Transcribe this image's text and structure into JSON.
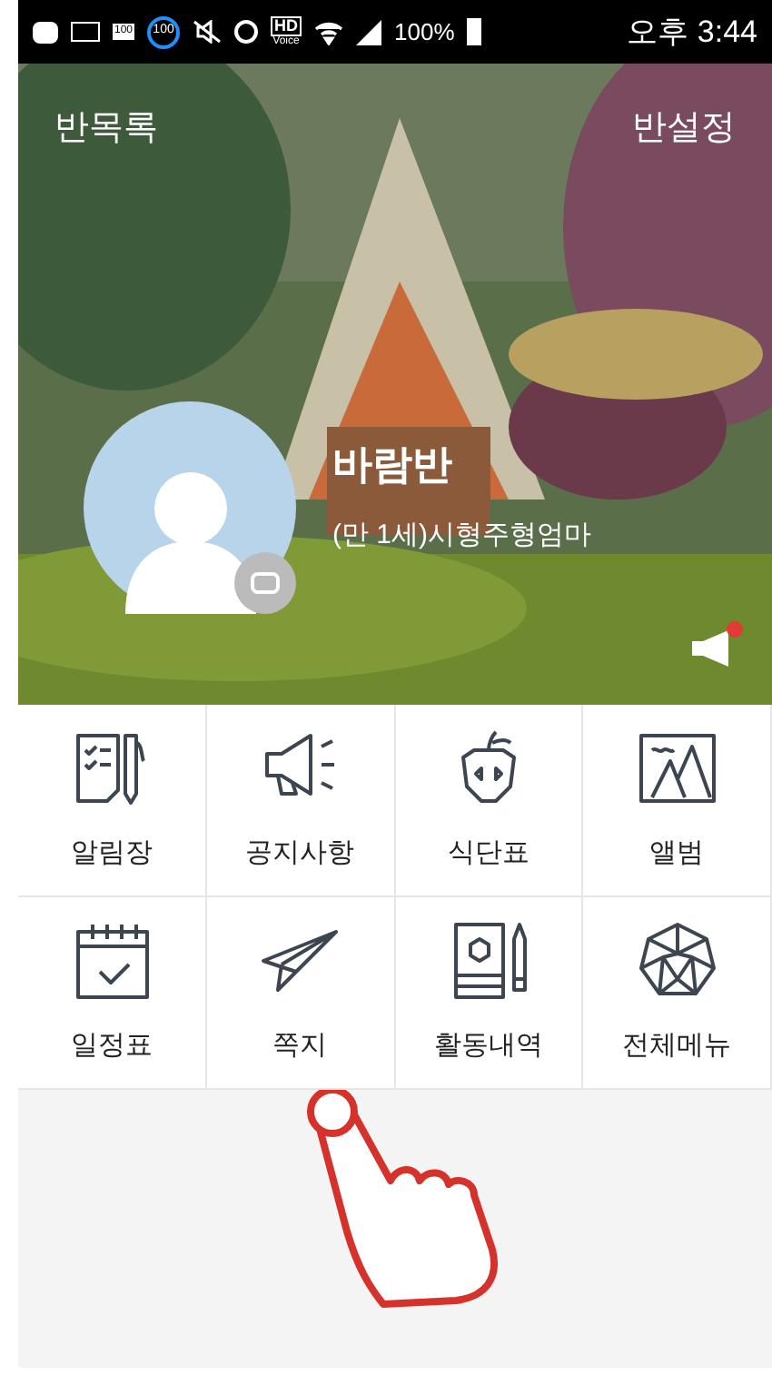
{
  "status_bar": {
    "badge_1": "100",
    "badge_2": "100",
    "hd": "HD",
    "voice": "Voice",
    "battery": "100%",
    "time": "오후 3:44"
  },
  "header": {
    "left": "반목록",
    "right": "반설정",
    "class_name": "바람반",
    "member": "(만 1세)시형주형엄마",
    "new_notice": true
  },
  "menu": [
    {
      "label": "알림장",
      "kind": "notes"
    },
    {
      "label": "공지사항",
      "kind": "megaphone"
    },
    {
      "label": "식단표",
      "kind": "apple"
    },
    {
      "label": "앨범",
      "kind": "album"
    },
    {
      "label": "일정표",
      "kind": "calendar"
    },
    {
      "label": "쪽지",
      "kind": "plane"
    },
    {
      "label": "활동내역",
      "kind": "book"
    },
    {
      "label": "전체메뉴",
      "kind": "polyhedron"
    }
  ]
}
